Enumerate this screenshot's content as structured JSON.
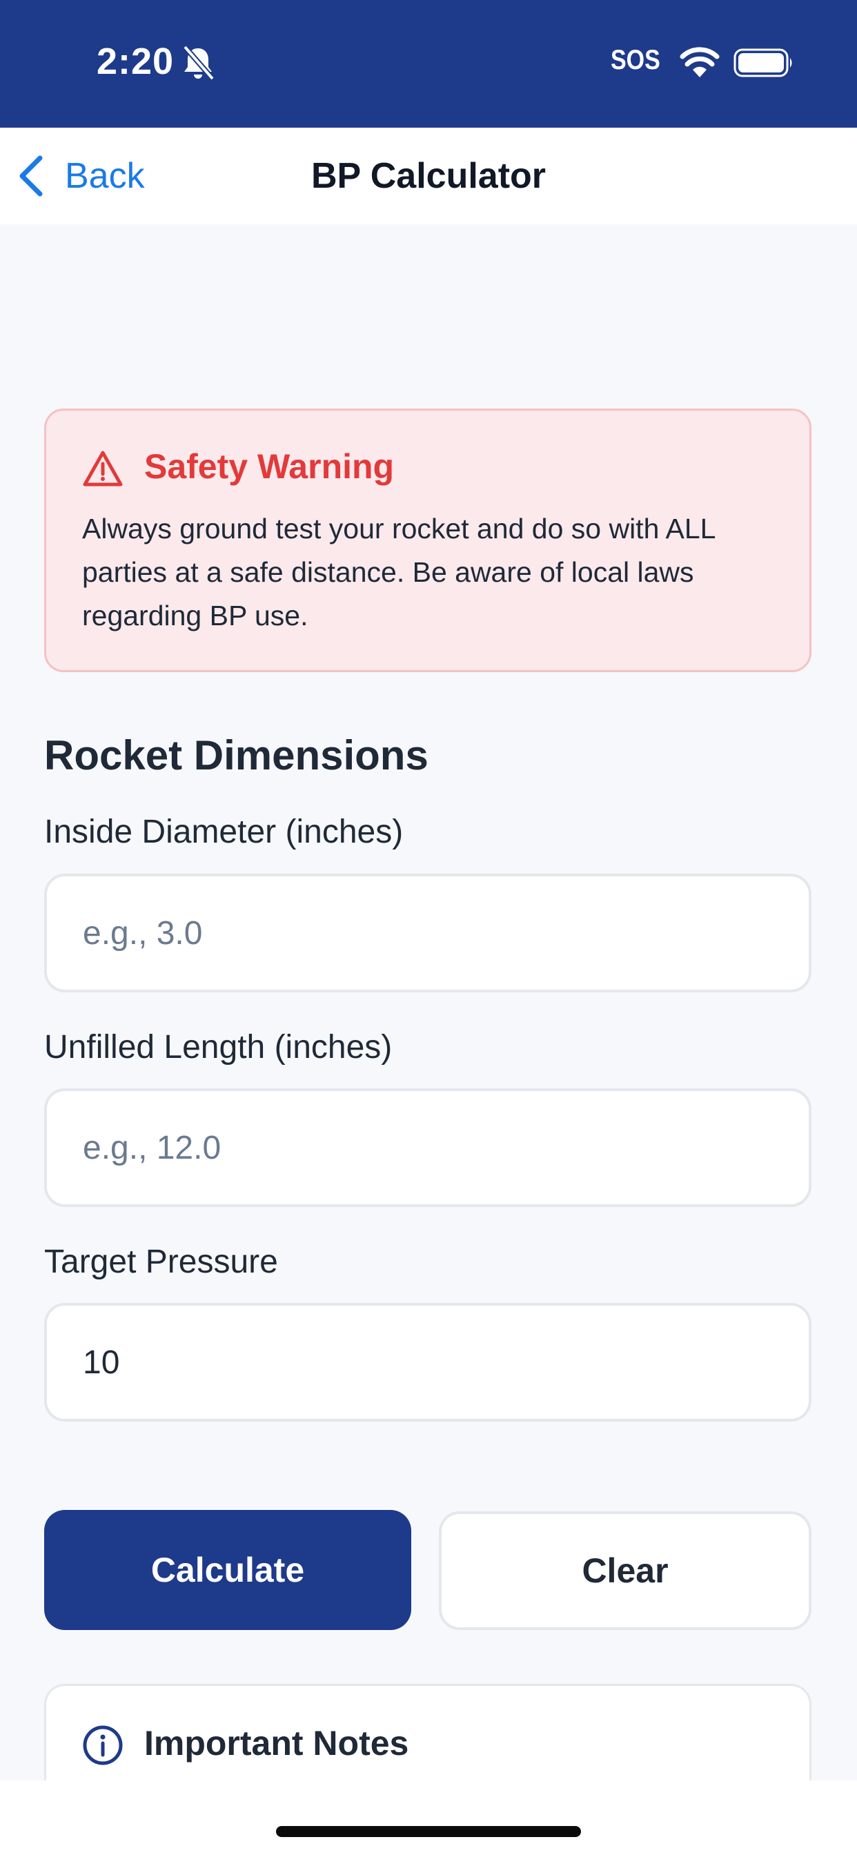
{
  "status_bar": {
    "time": "2:20",
    "sos": "SOS",
    "icons": [
      "bell-slash-icon",
      "wifi-icon",
      "battery-icon"
    ]
  },
  "nav": {
    "back_label": "Back",
    "title": "BP Calculator"
  },
  "warning": {
    "title": "Safety Warning",
    "body": "Always ground test your rocket and do so with ALL parties at a safe distance. Be aware of local laws regarding BP use.",
    "icon": "warning-triangle-icon"
  },
  "dimensions": {
    "section_title": "Rocket Dimensions",
    "inside_diameter": {
      "label": "Inside Diameter (inches)",
      "placeholder": "e.g., 3.0",
      "value": ""
    },
    "unfilled_length": {
      "label": "Unfilled Length (inches)",
      "placeholder": "e.g., 12.0",
      "value": ""
    },
    "target_pressure": {
      "label": "Target Pressure",
      "placeholder": "",
      "value": "10"
    }
  },
  "actions": {
    "calculate_label": "Calculate",
    "clear_label": "Clear"
  },
  "notes": {
    "title": "Important Notes",
    "icon": "info-circle-icon"
  },
  "colors": {
    "primary": "#1e3a8a",
    "link": "#1a7ae8",
    "warning_text": "#e23a3a",
    "warning_bg": "#fbe9ec",
    "warning_border": "#f5c2c2",
    "background": "#f6f8fb"
  }
}
